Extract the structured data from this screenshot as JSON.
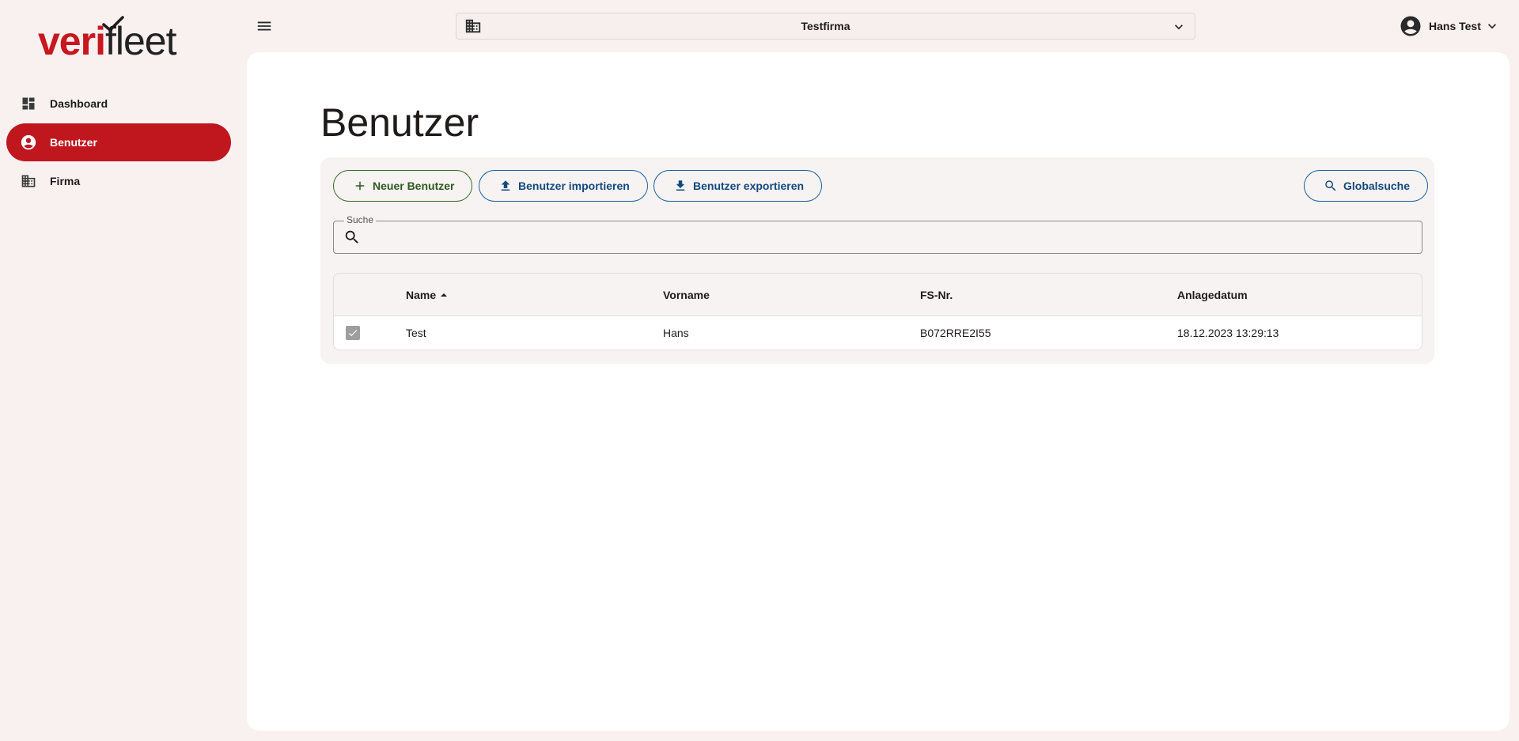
{
  "brand": {
    "logo_part1": "veri",
    "logo_part2": "fleet"
  },
  "sidebar": {
    "items": [
      {
        "label": "Dashboard",
        "icon": "dashboard-icon"
      },
      {
        "label": "Benutzer",
        "icon": "account-circle-icon",
        "active": true
      },
      {
        "label": "Firma",
        "icon": "building-icon"
      }
    ]
  },
  "topbar": {
    "company": "Testfirma",
    "user_name": "Hans Test"
  },
  "page": {
    "title": "Benutzer"
  },
  "toolbar": {
    "new_user_label": "Neuer Benutzer",
    "import_label": "Benutzer importieren",
    "export_label": "Benutzer exportieren",
    "global_search_label": "Globalsuche"
  },
  "search": {
    "label": "Suche",
    "value": ""
  },
  "table": {
    "columns": [
      "Name",
      "Vorname",
      "FS-Nr.",
      "Anlagedatum"
    ],
    "sort": {
      "column": "Name",
      "direction": "ascending"
    },
    "rows": [
      {
        "checked": true,
        "name": "Test",
        "vorname": "Hans",
        "fs_nr": "B072RRE2I55",
        "anlagedatum": "18.12.2023 13:29:13"
      }
    ]
  },
  "colors": {
    "brand_red": "#c0171f",
    "button_blue": "#13497e",
    "button_green": "#2e5a1f",
    "background": "#f8f1f0"
  }
}
